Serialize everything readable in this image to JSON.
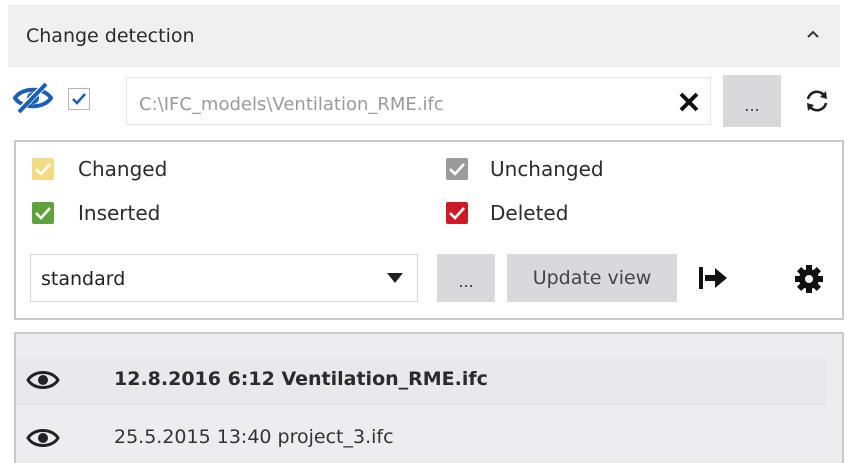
{
  "panel": {
    "title": "Change detection",
    "collapse_icon": "chevron-up-icon"
  },
  "file_row": {
    "visibility_icon": "eye-slash-icon",
    "enabled": true,
    "file_path": "C:\\IFC_models\\Ventilation_RME.ifc",
    "clear_icon": "close-icon",
    "browse_label": "...",
    "refresh_icon": "refresh-icon"
  },
  "legend": {
    "items": [
      {
        "label": "Changed",
        "color": "#f2dc83",
        "checked": true
      },
      {
        "label": "Unchanged",
        "color": "#9b9b9b",
        "checked": true
      },
      {
        "label": "Inserted",
        "color": "#5fa13a",
        "checked": true
      },
      {
        "label": "Deleted",
        "color": "#cc1b26",
        "checked": true
      }
    ]
  },
  "toolbar": {
    "preset_value": "standard",
    "preset_menu_label": "...",
    "update_label": "Update view",
    "export_icon": "export-arrow-icon",
    "settings_icon": "gear-icon"
  },
  "versions": [
    {
      "label": "12.8.2016 6:12 Ventilation_RME.ifc",
      "active": true,
      "icon": "eye-icon"
    },
    {
      "label": "25.5.2015 13:40 project_3.ifc",
      "active": false,
      "icon": "eye-icon"
    }
  ],
  "colors": {
    "accent_blue": "#1a5fb4",
    "header_bg": "#f0f0f0",
    "button_bg": "#d9d9dc"
  }
}
